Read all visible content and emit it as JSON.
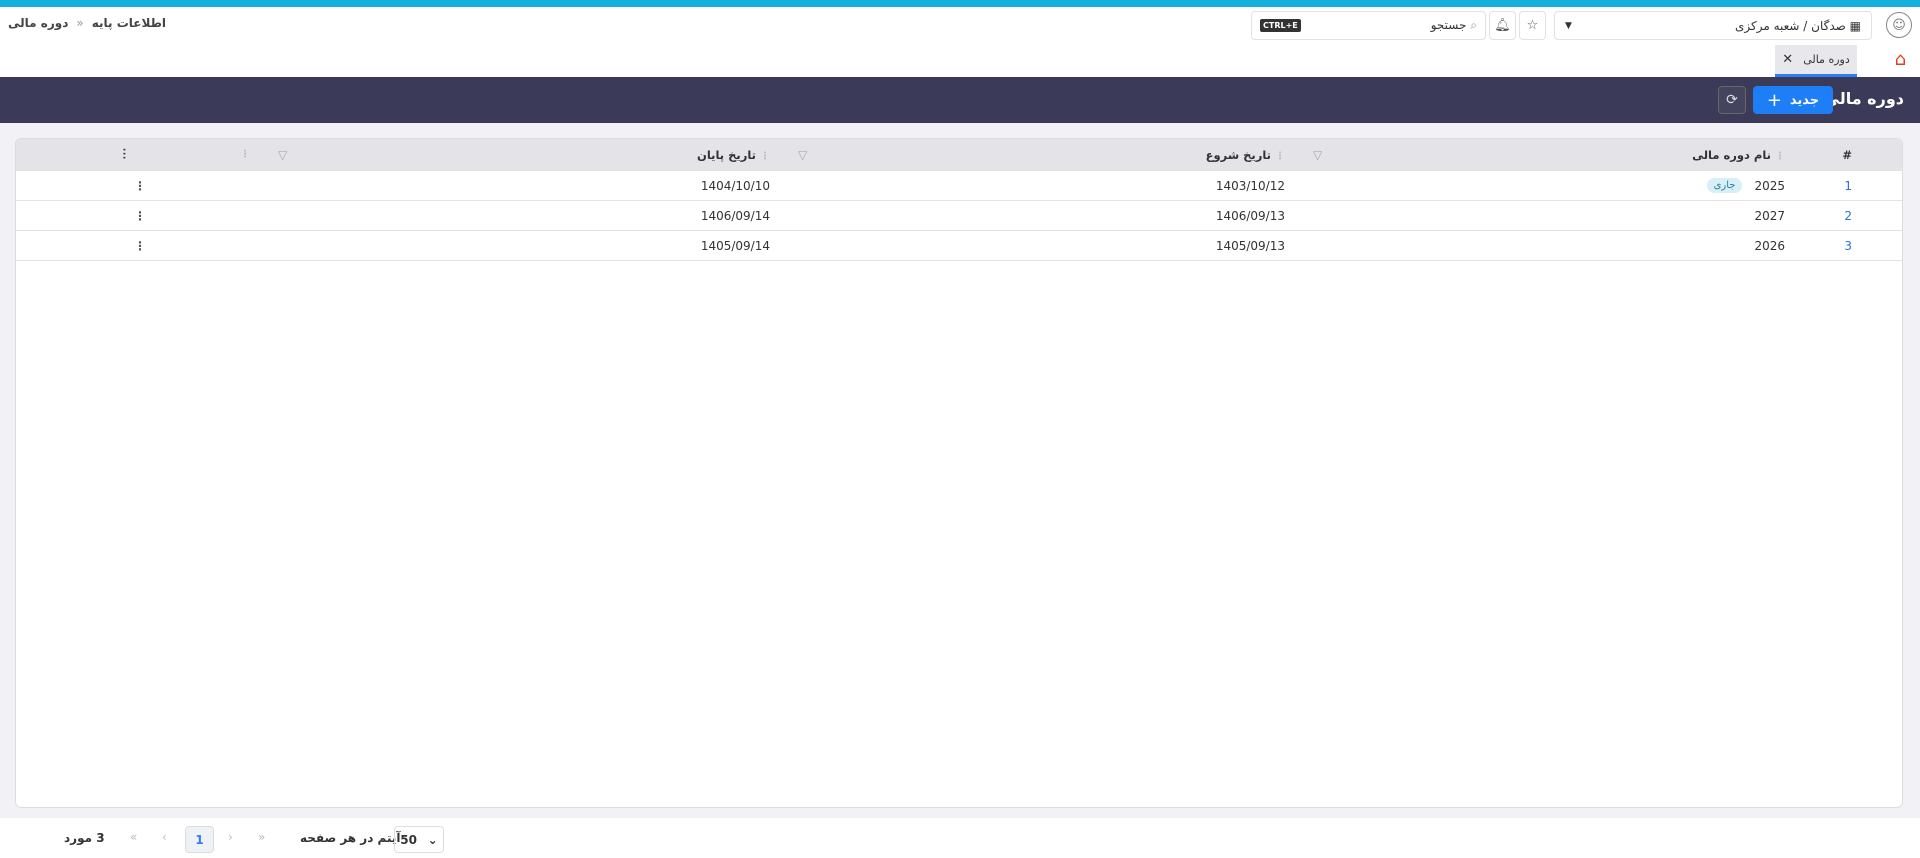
{
  "breadcrumb": {
    "items": [
      "اطلاعات پایه",
      "دوره مالی"
    ],
    "separator": "«"
  },
  "header": {
    "branch": "صدگان / شعبه مرکزی",
    "search_placeholder": "جستجو",
    "search_shortcut": "CTRL+E"
  },
  "tabs": [
    {
      "label": "دوره مالی"
    }
  ],
  "page": {
    "title": "دوره مالی",
    "new_label": "جدید"
  },
  "table": {
    "columns": [
      "#",
      "نام دوره مالی",
      "تاریخ شروع",
      "تاریخ پایان"
    ],
    "rows": [
      {
        "num": "1",
        "name": "2025",
        "badge": "جاری",
        "start": "1403/10/12",
        "end": "1404/10/10"
      },
      {
        "num": "2",
        "name": "2027",
        "badge": null,
        "start": "1406/09/13",
        "end": "1406/09/14"
      },
      {
        "num": "3",
        "name": "2026",
        "badge": null,
        "start": "1405/09/13",
        "end": "1405/09/14"
      }
    ]
  },
  "footer": {
    "count": "3 مورد",
    "current_page": "1",
    "per_page": "50",
    "per_page_label": "آیتم در هر صفحه"
  }
}
